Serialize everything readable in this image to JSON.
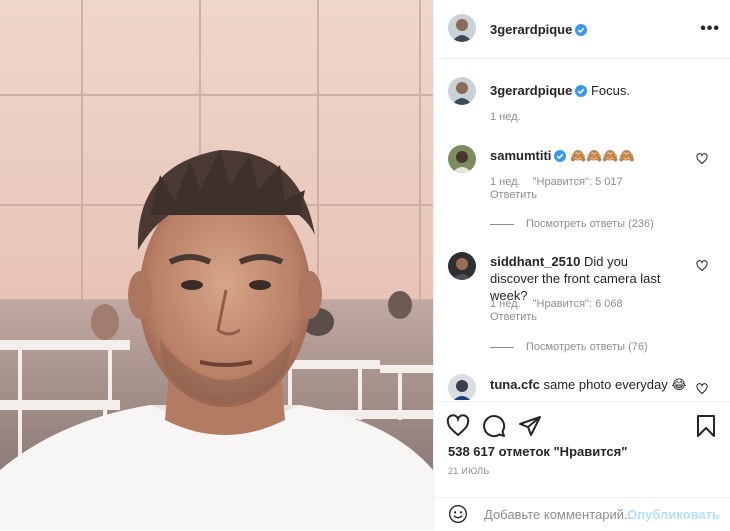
{
  "post": {
    "author": "3gerardpique",
    "caption": "Focus.",
    "caption_time": "1 нед.",
    "more_label": "•••",
    "likes_text": "538 617 отметок \"Нравится\"",
    "date": "21 ИЮЛЬ"
  },
  "comments": [
    {
      "user": "samumtiti",
      "verified": true,
      "text": "🙈🙈🙈🙈",
      "time": "1 нед.",
      "likes": "\"Нравится\": 5 017",
      "reply": "Ответить",
      "view_replies": "Посмотреть ответы (236)"
    },
    {
      "user": "siddhant_2510",
      "verified": false,
      "text": "Did you discover the front camera last week?",
      "time": "1 нед.",
      "likes": "\"Нравится\": 6 068",
      "reply": "Ответить",
      "view_replies": "Посмотреть ответы (76)"
    },
    {
      "user": "tuna.cfc",
      "verified": false,
      "text": "same photo everyday 😂"
    }
  ],
  "add_comment": {
    "placeholder": "Добавьте комментарий...",
    "post_label": "Опубликовать"
  },
  "colors": {
    "verified": "#3897f0",
    "post_button_disabled": "#b2dffc",
    "muted_text": "#8e8e8e"
  },
  "icons": [
    "heart-icon",
    "comment-icon",
    "share-icon",
    "bookmark-icon",
    "emoji-icon",
    "verified-icon",
    "more-options-icon"
  ]
}
